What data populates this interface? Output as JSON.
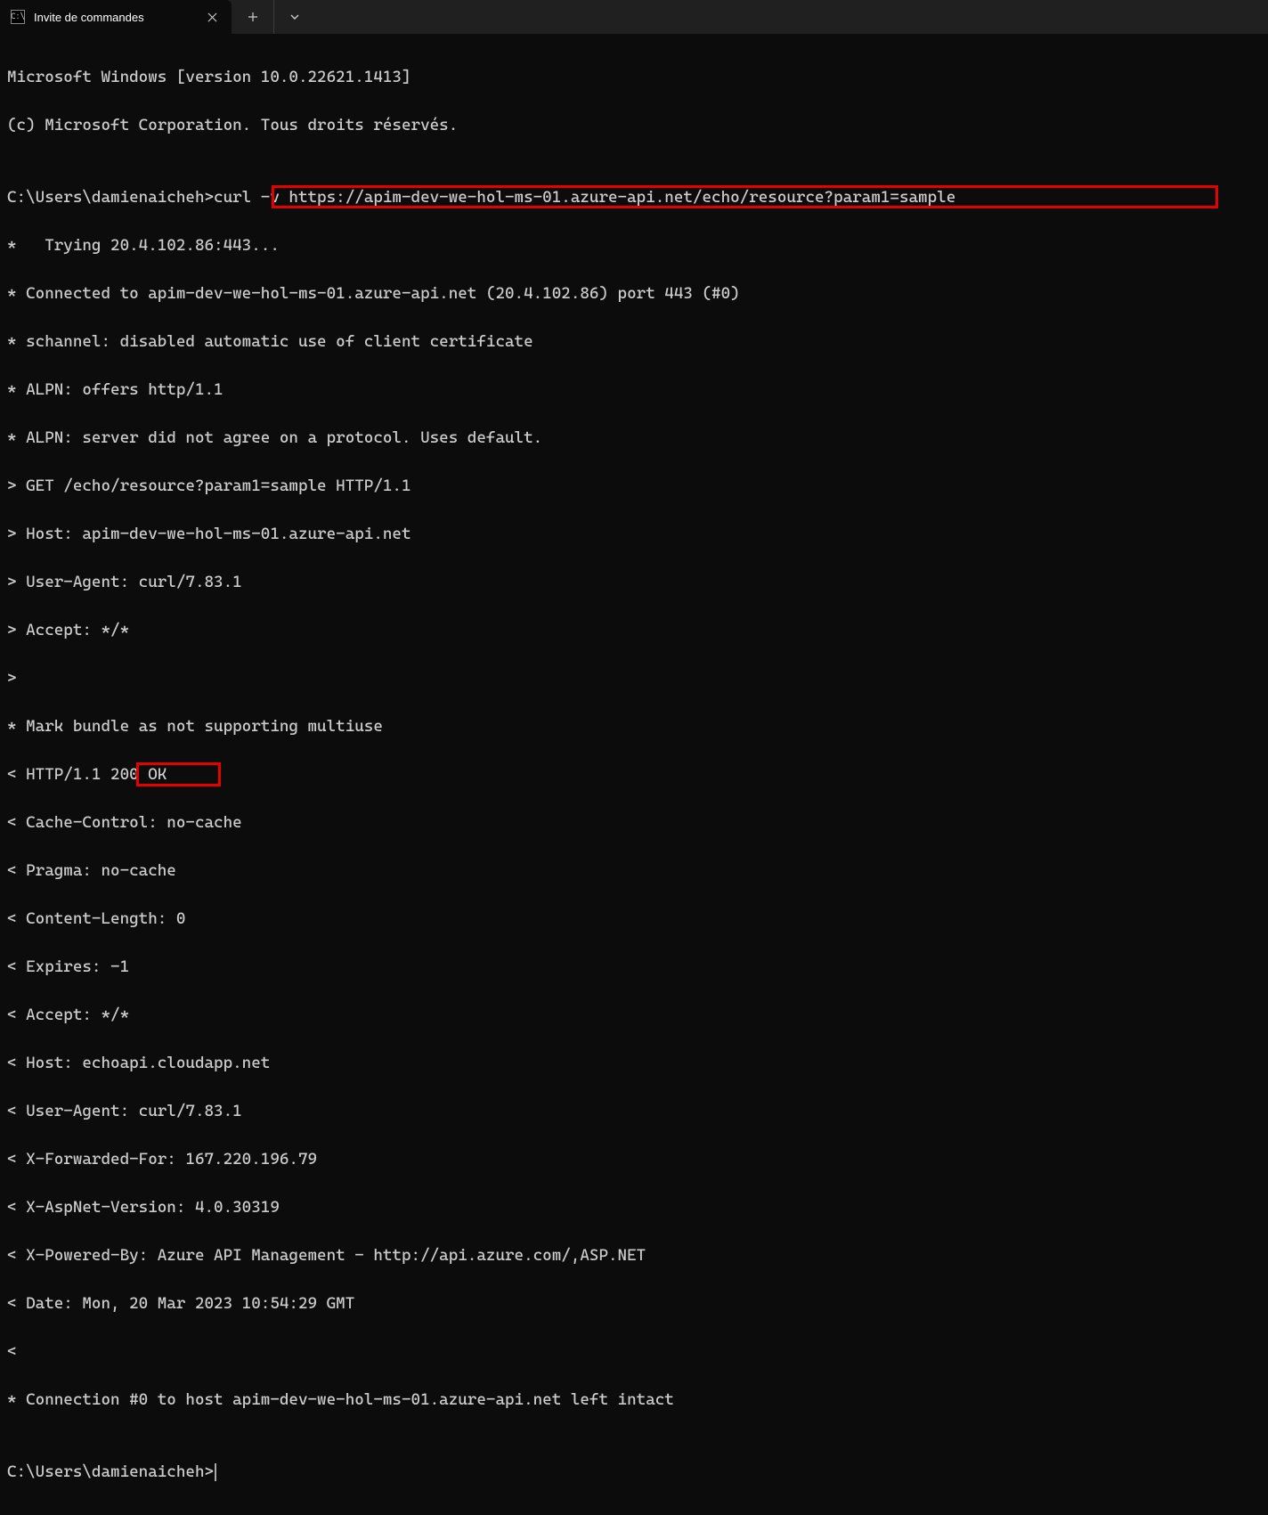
{
  "tab": {
    "title": "Invite de commandes"
  },
  "terminal": {
    "lines": [
      "Microsoft Windows [version 10.0.22621.1413]",
      "(c) Microsoft Corporation. Tous droits réservés.",
      "",
      "C:\\Users\\damienaicheh>curl -v https://apim-dev-we-hol-ms-01.azure-api.net/echo/resource?param1=sample",
      "*   Trying 20.4.102.86:443...",
      "* Connected to apim-dev-we-hol-ms-01.azure-api.net (20.4.102.86) port 443 (#0)",
      "* schannel: disabled automatic use of client certificate",
      "* ALPN: offers http/1.1",
      "* ALPN: server did not agree on a protocol. Uses default.",
      "> GET /echo/resource?param1=sample HTTP/1.1",
      "> Host: apim-dev-we-hol-ms-01.azure-api.net",
      "> User-Agent: curl/7.83.1",
      "> Accept: */*",
      ">",
      "* Mark bundle as not supporting multiuse",
      "< HTTP/1.1 200 OK",
      "< Cache-Control: no-cache",
      "< Pragma: no-cache",
      "< Content-Length: 0",
      "< Expires: -1",
      "< Accept: */*",
      "< Host: echoapi.cloudapp.net",
      "< User-Agent: curl/7.83.1",
      "< X-Forwarded-For: 167.220.196.79",
      "< X-AspNet-Version: 4.0.30319",
      "< X-Powered-By: Azure API Management - http://api.azure.com/,ASP.NET",
      "< Date: Mon, 20 Mar 2023 10:54:29 GMT",
      "<",
      "* Connection #0 to host apim-dev-we-hol-ms-01.azure-api.net left intact",
      "",
      "C:\\Users\\damienaicheh>"
    ]
  },
  "highlights": {
    "command_line_index": 3,
    "status_line_index": 15
  }
}
